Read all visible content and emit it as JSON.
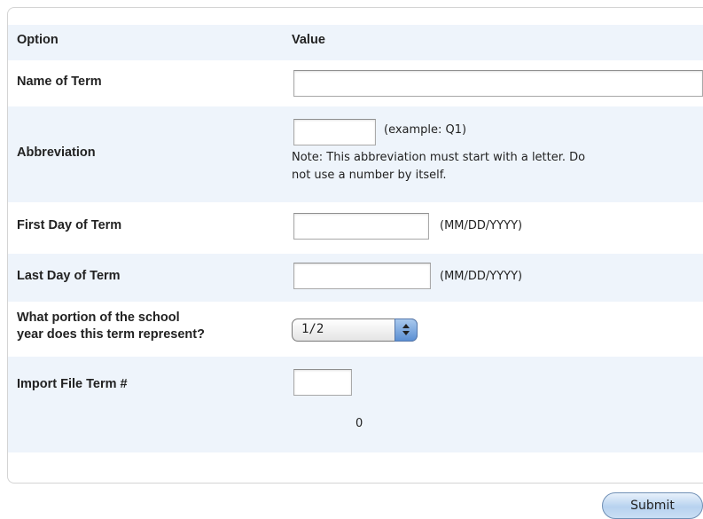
{
  "table": {
    "header": {
      "option": "Option",
      "value": "Value"
    },
    "rows": {
      "name_of_term": {
        "label": "Name of Term",
        "value": ""
      },
      "abbreviation": {
        "label": "Abbreviation",
        "value": "",
        "example": "(example: Q1)",
        "note_line1": "Note: This abbreviation must start with a letter. Do",
        "note_line2": "not use a number by itself."
      },
      "first_day": {
        "label": "First Day of Term",
        "value": "",
        "format_hint": "(MM/DD/YYYY)"
      },
      "last_day": {
        "label": "Last Day of Term",
        "value": "",
        "format_hint": "(MM/DD/YYYY)"
      },
      "portion": {
        "label_line1": "What portion of the school",
        "label_line2": "year does this term represent?",
        "selected": "1/2"
      },
      "import_file_term": {
        "label": "Import File Term #",
        "value": "",
        "count": "0"
      }
    }
  },
  "submit_label": "Submit"
}
